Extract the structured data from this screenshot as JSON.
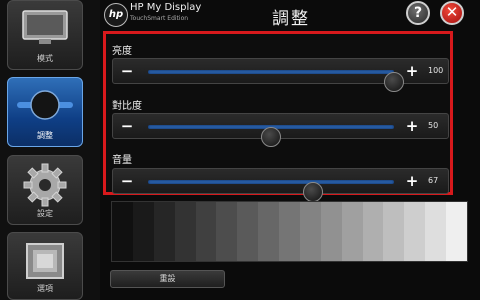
{
  "header": {
    "logo_text": "hp",
    "app_title": "HP My Display",
    "app_subtitle": "TouchSmart Edition",
    "page_title": "調整",
    "help_symbol": "?",
    "close_symbol": "✕",
    "help_icon": "question-mark-icon",
    "close_icon": "close-icon"
  },
  "sidebar": {
    "items": [
      {
        "label": "模式",
        "icon": "monitor-icon",
        "active": false
      },
      {
        "label": "調整",
        "icon": "slider-knob-icon",
        "active": true
      },
      {
        "label": "設定",
        "icon": "gear-icon",
        "active": false
      },
      {
        "label": "選項",
        "icon": "picture-frame-icon",
        "active": false
      }
    ]
  },
  "controls": [
    {
      "label": "亮度",
      "value": "100",
      "level_percent": 100
    },
    {
      "label": "對比度",
      "value": "50",
      "level_percent": 50
    },
    {
      "label": "音量",
      "value": "67",
      "level_percent": 67
    }
  ],
  "slider_glyphs": {
    "minus": "−",
    "plus": "+"
  },
  "gray_steps": [
    "#101010",
    "#1a1a1a",
    "#262626",
    "#333333",
    "#404040",
    "#4d4d4d",
    "#5a5a5a",
    "#676767",
    "#757575",
    "#838383",
    "#919191",
    "#a0a0a0",
    "#afafaf",
    "#bebebe",
    "#cecece",
    "#dedede",
    "#efefef"
  ],
  "reset_label": "重設",
  "colors": {
    "accent_blue": "#1f5fbf",
    "highlight_red": "#d7191c",
    "close_red": "#c8201a"
  }
}
